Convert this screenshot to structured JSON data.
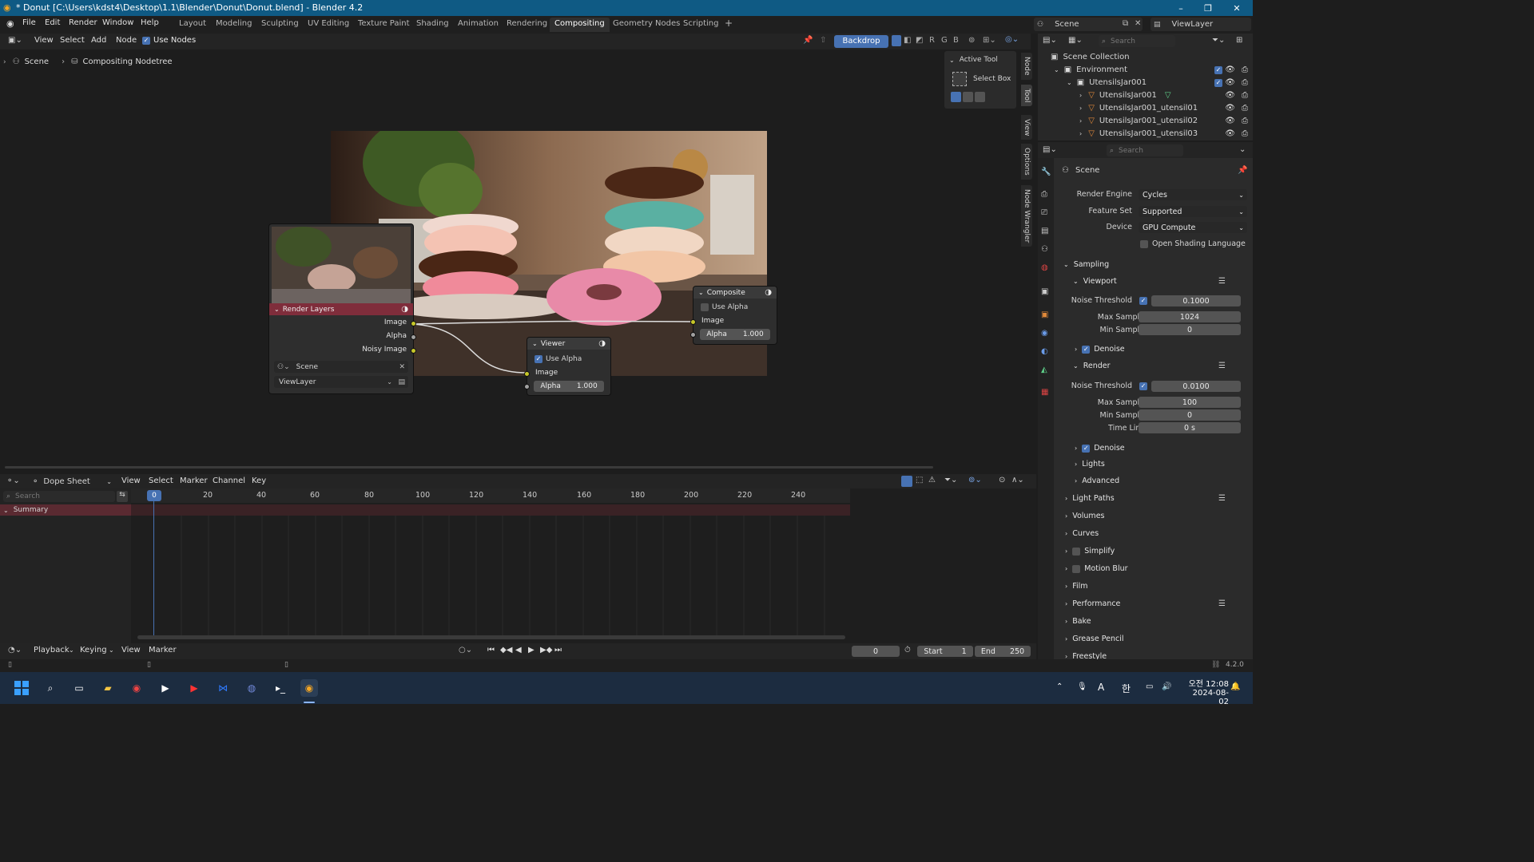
{
  "window": {
    "title": "* Donut [C:\\Users\\kdst4\\Desktop\\1.1\\Blender\\Donut\\Donut.blend] - Blender 4.2",
    "minimize": "–",
    "maximize": "❐",
    "close": "✕"
  },
  "menus": [
    "File",
    "Edit",
    "Render",
    "Window",
    "Help"
  ],
  "workspaces": [
    "Layout",
    "Modeling",
    "Sculpting",
    "UV Editing",
    "Texture Paint",
    "Shading",
    "Animation",
    "Rendering",
    "Compositing",
    "Geometry Nodes",
    "Scripting"
  ],
  "active_workspace": "Compositing",
  "add_workspace": "+",
  "scene_selector": "Scene",
  "viewlayer_selector": "ViewLayer",
  "node_header": {
    "view": "View",
    "select": "Select",
    "add": "Add",
    "node": "Node",
    "use_nodes": "Use Nodes",
    "backdrop": "Backdrop",
    "channels": [
      "R",
      "G",
      "B"
    ]
  },
  "breadcrumb": {
    "scene": "Scene",
    "tree": "Compositing Nodetree"
  },
  "sidebar_tabs": [
    "Node",
    "Tool",
    "View",
    "Options",
    "Node Wrangler"
  ],
  "active_tool": {
    "header": "Active Tool",
    "tool": "Select Box"
  },
  "nodes": {
    "render_layers": {
      "title": "Render Layers",
      "outputs": [
        "Image",
        "Alpha",
        "Noisy Image"
      ],
      "scene": "Scene",
      "layer": "ViewLayer"
    },
    "composite": {
      "title": "Composite",
      "use_alpha": "Use Alpha",
      "input": "Image",
      "alpha_label": "Alpha",
      "alpha_value": "1.000"
    },
    "viewer": {
      "title": "Viewer",
      "use_alpha": "Use Alpha",
      "input": "Image",
      "alpha_label": "Alpha",
      "alpha_value": "1.000"
    }
  },
  "outliner": {
    "search": "Search",
    "root": "Scene Collection",
    "items": [
      {
        "name": "Environment"
      },
      {
        "name": "UtensilsJar001"
      },
      {
        "name": "UtensilsJar001"
      },
      {
        "name": "UtensilsJar001_utensil01"
      },
      {
        "name": "UtensilsJar001_utensil02"
      },
      {
        "name": "UtensilsJar001_utensil03"
      }
    ]
  },
  "properties": {
    "search": "Search",
    "context": "Scene",
    "render_engine": {
      "label": "Render Engine",
      "value": "Cycles"
    },
    "feature_set": {
      "label": "Feature Set",
      "value": "Supported"
    },
    "device": {
      "label": "Device",
      "value": "GPU Compute"
    },
    "osl": "Open Shading Language",
    "sampling": "Sampling",
    "viewport": "Viewport",
    "vp_noise": {
      "label": "Noise Threshold",
      "value": "0.1000"
    },
    "vp_max": {
      "label": "Max Samples",
      "value": "1024"
    },
    "vp_min": {
      "label": "Min Samples",
      "value": "0"
    },
    "vp_denoise": "Denoise",
    "render": "Render",
    "r_noise": {
      "label": "Noise Threshold",
      "value": "0.0100"
    },
    "r_max": {
      "label": "Max Samples",
      "value": "100"
    },
    "r_min": {
      "label": "Min Samples",
      "value": "0"
    },
    "r_time": {
      "label": "Time Limit",
      "value": "0 s"
    },
    "r_denoise": "Denoise",
    "lights": "Lights",
    "advanced": "Advanced",
    "panels": [
      "Light Paths",
      "Volumes",
      "Curves",
      "Simplify",
      "Motion Blur",
      "Film",
      "Performance",
      "Bake",
      "Grease Pencil",
      "Freestyle"
    ]
  },
  "dopesheet": {
    "editor": "Dope Sheet",
    "menus": [
      "View",
      "Select",
      "Marker",
      "Channel",
      "Key"
    ],
    "search": "Search",
    "summary": "Summary",
    "ruler": [
      "0",
      "20",
      "40",
      "60",
      "80",
      "100",
      "120",
      "140",
      "160",
      "180",
      "200",
      "220",
      "240"
    ]
  },
  "timeline": {
    "playback": "Playback",
    "keying": "Keying",
    "view": "View",
    "marker": "Marker",
    "current_frame": "0",
    "start_label": "Start",
    "start": "1",
    "end_label": "End",
    "end": "250"
  },
  "version": "4.2.0",
  "clock": {
    "ampm": "오전 12:08",
    "date": "2024-08-02"
  },
  "ime": {
    "lang": "A",
    "mode": "한"
  },
  "colors": {
    "accent": "#4772b3",
    "titlebar": "#0f5a84",
    "render_layers_header": "#8b2f3e",
    "node_header": "#3a3a3a",
    "socket_image": "#c7c729",
    "socket_value": "#a1a1a1"
  }
}
